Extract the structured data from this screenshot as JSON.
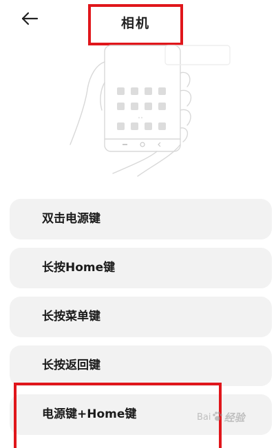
{
  "header": {
    "title": "相机"
  },
  "icons": {
    "back": "arrow-left-icon",
    "illustration": "hand-holding-phone-illustration"
  },
  "gestures": {
    "items": [
      {
        "label": "双击电源键"
      },
      {
        "label": "长按Home键"
      },
      {
        "label": "长按菜单键"
      },
      {
        "label": "长按返回键"
      },
      {
        "label": "电源键+Home键"
      }
    ]
  },
  "watermark": {
    "text_left": "Bai",
    "text_right": "经验"
  },
  "colors": {
    "highlight": "#e0161b",
    "item_background": "#f2f2f2"
  }
}
